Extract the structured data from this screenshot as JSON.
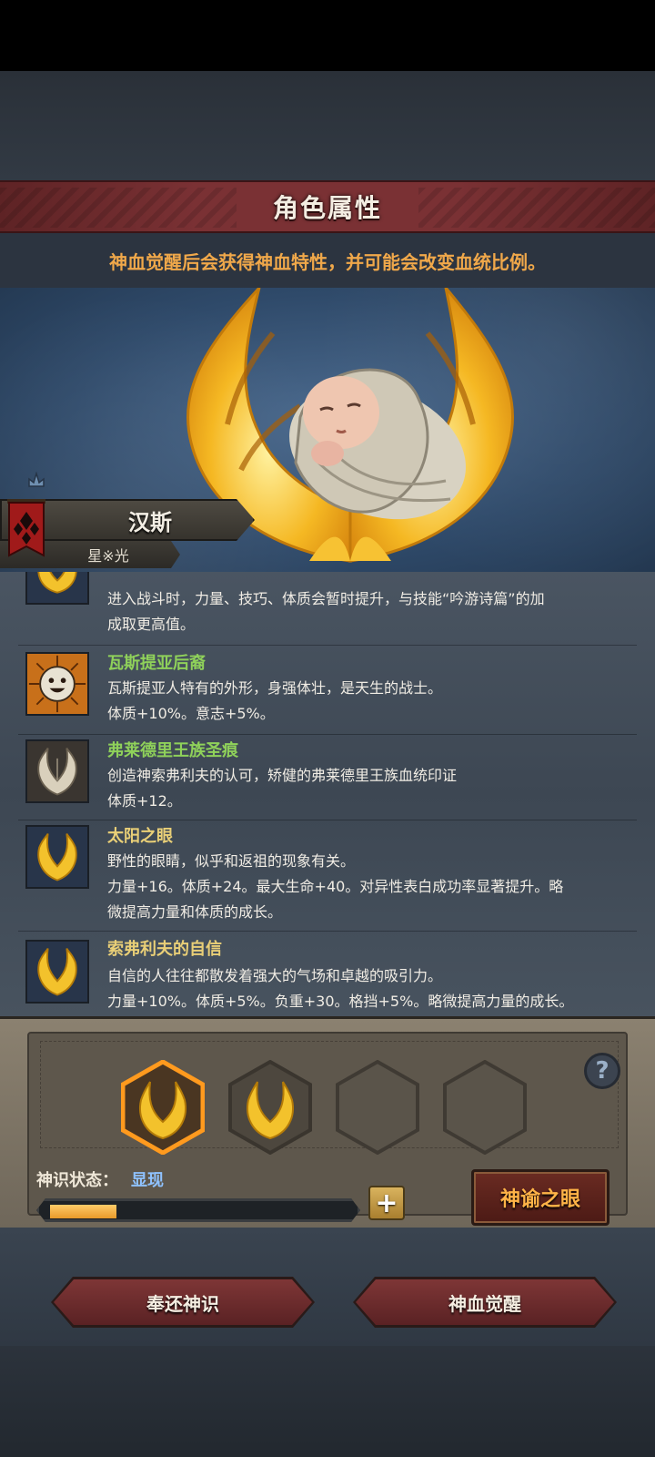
{
  "header": {
    "title": "角色属性"
  },
  "notice": {
    "text": "神血觉醒后会获得神血特性，并可能会改变血统比例。"
  },
  "character": {
    "name": "汉斯",
    "subtitle": "星※光"
  },
  "traits": [
    {
      "name": "",
      "lines": [
        "进入战斗时，力量、技巧、体质会暂时提升，与技能“吟游诗篇”的加",
        "成取更高值。"
      ],
      "icon": "golden-wings-icon",
      "name_color": "#e9cf77"
    },
    {
      "name": "瓦斯提亚后裔",
      "lines": [
        "瓦斯提亚人特有的外形，身强体壮，是天生的战士。",
        "体质+10%。意志+5%。"
      ],
      "icon": "smiley-face-icon",
      "name_color": "#8fd15a"
    },
    {
      "name": "弗莱德里王族圣痕",
      "lines": [
        "创造神索弗利夫的认可，矫健的弗莱德里王族血统印证",
        "体质+12。"
      ],
      "icon": "silver-wings-icon",
      "name_color": "#8fd15a"
    },
    {
      "name": "太阳之眼",
      "lines": [
        "野性的眼睛，似乎和返祖的现象有关。",
        "力量+16。体质+24。最大生命+40。对异性表白成功率显著提升。略",
        "微提高力量和体质的成长。"
      ],
      "icon": "golden-wings-icon",
      "name_color": "#e9cf77"
    },
    {
      "name": "索弗利夫的自信",
      "lines": [
        "自信的人往往都散发着强大的气场和卓越的吸引力。",
        "力量+10%。体质+5%。负重+30。格挡+5%。略微提高力量的成长。"
      ],
      "icon": "golden-wings-icon",
      "name_color": "#e9cf77"
    }
  ],
  "divine": {
    "status_label": "神识状态：",
    "status_value": "显现",
    "progress": 0.22,
    "plus": "+",
    "help": "?",
    "oracle_button": "神谕之眼"
  },
  "actions": {
    "return": "奉还神识",
    "awaken": "神血觉醒"
  },
  "colors": {
    "title_red": "#7a3134",
    "accent_orange": "#f0a84a",
    "status_blue": "#8fc2ff"
  }
}
